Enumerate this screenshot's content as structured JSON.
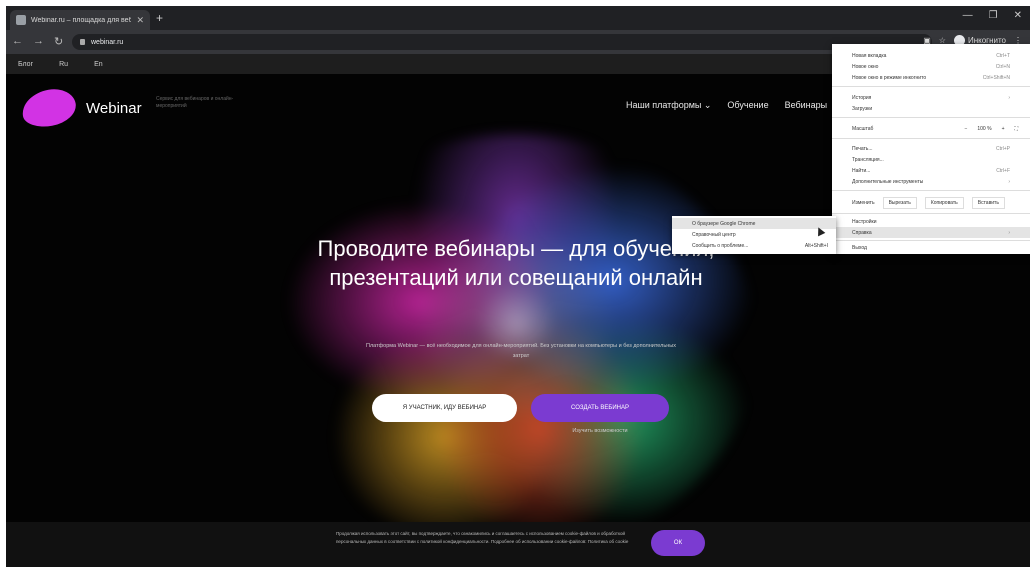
{
  "browser": {
    "tab_title": "Webinar.ru – площадка для веб…",
    "url": "webinar.ru",
    "profile_label": "Инкогнито",
    "bookmarks": [
      "Блог",
      "Ru",
      "En"
    ]
  },
  "site": {
    "brand": "Webinar",
    "tagline": "Сервис для вебинаров и онлайн-мероприятий",
    "nav": [
      "Наши платформы ⌄",
      "Обучение",
      "Вебинары"
    ],
    "headline": "Проводите вебинары — для обучения, презентаций или совещаний онлайн",
    "subtext": "Платформа Webinar — всё необходимое для онлайн-мероприятий. Без установки на компьютеры и без дополнительных затрат",
    "btn_join": "Я УЧАСТНИК, ИДУ ВЕБИНАР",
    "btn_create": "СОЗДАТЬ ВЕБИНАР",
    "link_more": "Изучить возможности",
    "cookie_text": "Продолжая использовать этот сайт, вы подтверждаете, что ознакомились и соглашаетесь с использованием cookie-файлов и обработкой персональных данных в соответствии с политикой конфиденциальности. Подробнее об использовании cookie-файлов: Политика об cookie",
    "cookie_ok": "ОК"
  },
  "menu": {
    "items": [
      {
        "label": "Новая вкладка",
        "shortcut": "Ctrl+T"
      },
      {
        "label": "Новое окно",
        "shortcut": "Ctrl+N"
      },
      {
        "label": "Новое окно в режиме инкогнито",
        "shortcut": "Ctrl+Shift+N"
      },
      {
        "label": "История",
        "shortcut": "›"
      },
      {
        "label": "Загрузки",
        "shortcut": ""
      },
      {
        "label": "Печать...",
        "shortcut": "Ctrl+P"
      },
      {
        "label": "Трансляция...",
        "shortcut": ""
      },
      {
        "label": "Найти...",
        "shortcut": "Ctrl+F"
      },
      {
        "label": "Дополнительные инструменты",
        "shortcut": "›"
      }
    ],
    "zoom_label": "Масштаб",
    "zoom_minus": "−",
    "zoom_value": "100 %",
    "zoom_plus": "+",
    "edit_label": "Изменить",
    "edit_cut": "Вырезать",
    "edit_copy": "Копировать",
    "edit_paste": "Вставить",
    "settings": "Настройки",
    "help": "Справка",
    "exit": "Выход"
  },
  "submenu": {
    "items": [
      {
        "label": "О браузере Google Chrome",
        "shortcut": ""
      },
      {
        "label": "Справочный центр",
        "shortcut": ""
      },
      {
        "label": "Сообщить о проблеме...",
        "shortcut": "Alt+Shift+I"
      }
    ]
  }
}
